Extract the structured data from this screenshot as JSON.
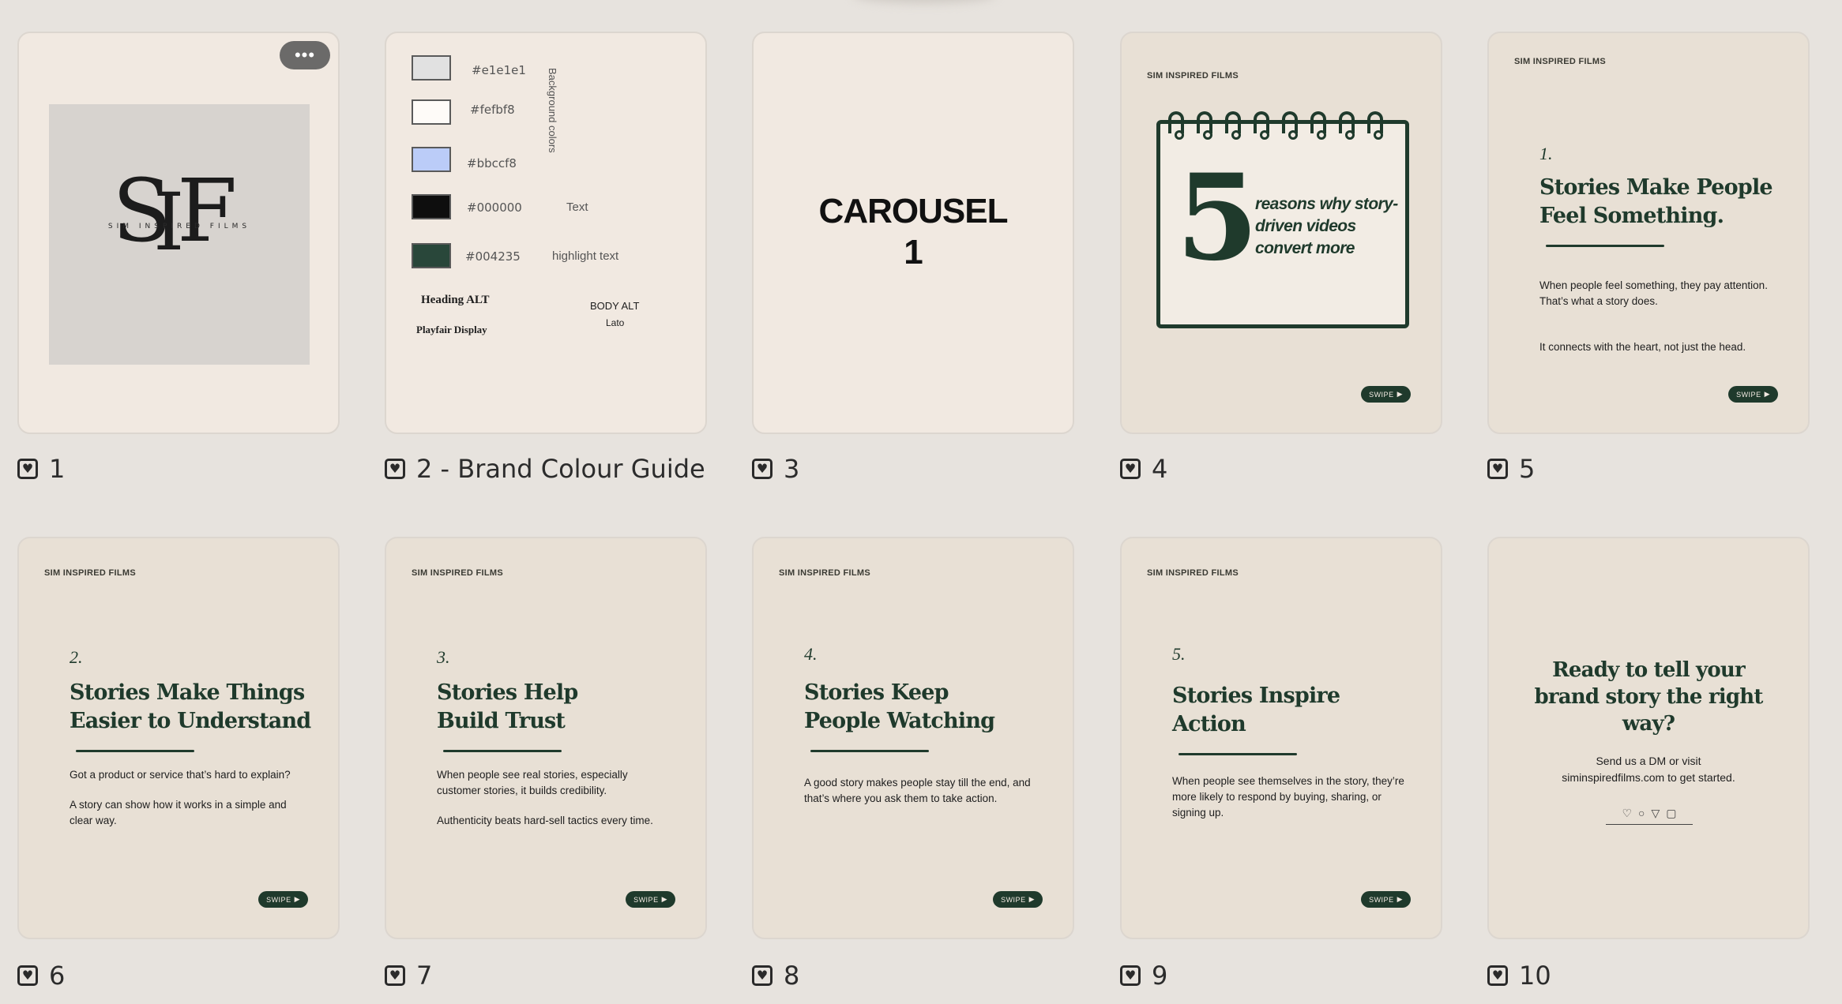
{
  "menu": {
    "more_label": "•••"
  },
  "caption_icon": "heart-icon",
  "captions": [
    "1",
    "2 - Brand Colour Guide",
    "3",
    "4",
    "5",
    "6",
    "7",
    "8",
    "9",
    "10"
  ],
  "slide1": {
    "logo_letters": [
      "S",
      "I",
      "F"
    ],
    "logo_subtitle": "SIM INSPIRED FILMS"
  },
  "slide2": {
    "swatches": [
      {
        "hex": "#e1e1e1",
        "label": "#e1e1e1",
        "role": ""
      },
      {
        "hex": "#fefbf8",
        "label": "#fefbf8",
        "role": ""
      },
      {
        "hex": "#bbccf8",
        "label": "#bbccf8",
        "role": ""
      },
      {
        "hex": "#000000",
        "label": "#000000",
        "role": "Text"
      },
      {
        "hex": "#004235",
        "label": "#004235",
        "role": "highlight text"
      }
    ],
    "vertical_label": "Background colors",
    "heading_font_label": "Heading ALT",
    "heading_font_name": "Playfair Display",
    "body_font_label": "BODY ALT",
    "body_font_name": "Lato"
  },
  "slide3": {
    "line1": "CAROUSEL",
    "line2": "1"
  },
  "brand": "SIM INSPIRED FILMS",
  "swipe_label": "SWIPE",
  "slide4": {
    "big_number": "5",
    "text": "reasons why story-driven videos convert more"
  },
  "slides": [
    {
      "num": "1.",
      "title": "Stories Make People Feel Something.",
      "paragraphs": [
        "When people feel something, they pay attention.\nThat’s what a story does.",
        "It connects with the heart, not just the head."
      ]
    },
    {
      "num": "2.",
      "title": "Stories Make Things Easier to Understand",
      "paragraphs": [
        "Got a product or service that’s hard to explain?",
        "A story can show how it works in a simple and clear way."
      ]
    },
    {
      "num": "3.",
      "title": "Stories Help Build Trust",
      "paragraphs": [
        "When people see real stories, especially customer stories, it builds credibility.",
        "Authenticity beats hard-sell tactics every time."
      ]
    },
    {
      "num": "4.",
      "title": "Stories Keep People Watching",
      "paragraphs": [
        "A good story makes people stay till the end, and that’s where you ask them to take action."
      ]
    },
    {
      "num": "5.",
      "title": "Stories Inspire Action",
      "paragraphs": [
        "When people see themselves in the story, they’re more likely to respond by buying, sharing, or signing up."
      ]
    }
  ],
  "slide10": {
    "title": "Ready to tell your brand story the right way?",
    "body_line1": "Send us a DM or visit",
    "body_line2": "siminspiredfilms.com to get started.",
    "icons": [
      "♡",
      "○",
      "▽",
      "▢"
    ]
  },
  "colors": {
    "accent": "#1f3a2c",
    "card": "#f1e9e1",
    "page": "#e7e3de"
  }
}
